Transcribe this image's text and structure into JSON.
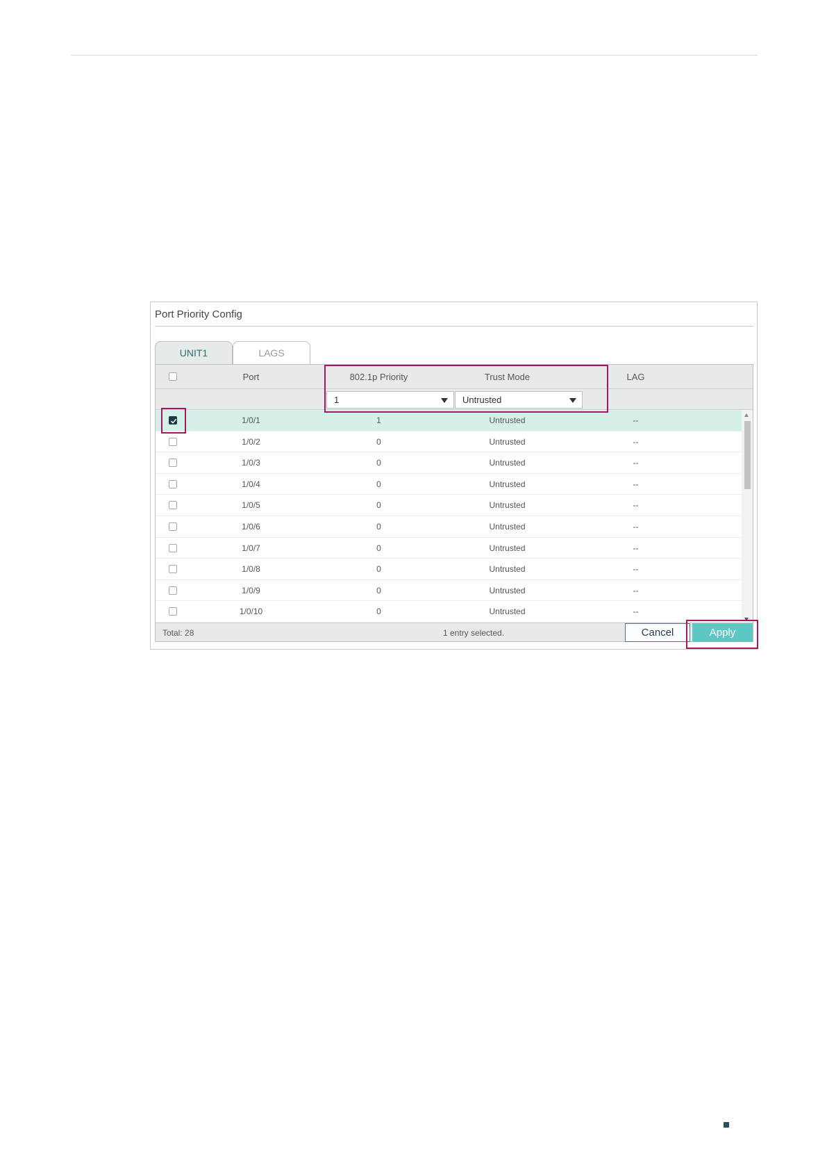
{
  "panel": {
    "title": "Port Priority Config",
    "tabs": [
      {
        "label": "UNIT1",
        "active": true
      },
      {
        "label": "LAGS",
        "active": false
      }
    ]
  },
  "table": {
    "columns": {
      "port": "Port",
      "priority": "802.1p Priority",
      "trust": "Trust Mode",
      "lag": "LAG"
    },
    "filter": {
      "priority_value": "1",
      "trust_value": "Untrusted"
    },
    "rows": [
      {
        "port": "1/0/1",
        "priority": "1",
        "trust": "Untrusted",
        "lag": "--",
        "checked": true
      },
      {
        "port": "1/0/2",
        "priority": "0",
        "trust": "Untrusted",
        "lag": "--",
        "checked": false
      },
      {
        "port": "1/0/3",
        "priority": "0",
        "trust": "Untrusted",
        "lag": "--",
        "checked": false
      },
      {
        "port": "1/0/4",
        "priority": "0",
        "trust": "Untrusted",
        "lag": "--",
        "checked": false
      },
      {
        "port": "1/0/5",
        "priority": "0",
        "trust": "Untrusted",
        "lag": "--",
        "checked": false
      },
      {
        "port": "1/0/6",
        "priority": "0",
        "trust": "Untrusted",
        "lag": "--",
        "checked": false
      },
      {
        "port": "1/0/7",
        "priority": "0",
        "trust": "Untrusted",
        "lag": "--",
        "checked": false
      },
      {
        "port": "1/0/8",
        "priority": "0",
        "trust": "Untrusted",
        "lag": "--",
        "checked": false
      },
      {
        "port": "1/0/9",
        "priority": "0",
        "trust": "Untrusted",
        "lag": "--",
        "checked": false
      },
      {
        "port": "1/0/10",
        "priority": "0",
        "trust": "Untrusted",
        "lag": "--",
        "checked": false
      }
    ]
  },
  "footer": {
    "total": "Total: 28",
    "selected_info": "1 entry selected.",
    "cancel_label": "Cancel",
    "apply_label": "Apply"
  },
  "colors": {
    "accent": "#5ec6c3",
    "selected_row": "#d5efe9",
    "highlight": "#a3195b"
  },
  "icons": [
    "checkbox",
    "check-icon",
    "dropdown-arrow-icon",
    "scroll-up-icon",
    "scroll-down-icon"
  ]
}
